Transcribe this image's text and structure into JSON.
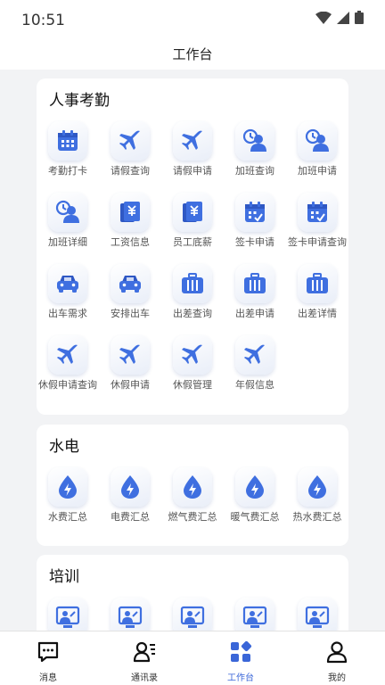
{
  "status": {
    "time": "10:51"
  },
  "header": {
    "title": "工作台"
  },
  "sections": [
    {
      "title": "人事考勤",
      "items": [
        {
          "label": "考勤打卡",
          "icon": "calendar-icon"
        },
        {
          "label": "请假查询",
          "icon": "airplane-icon"
        },
        {
          "label": "请假申请",
          "icon": "airplane-icon"
        },
        {
          "label": "加班查询",
          "icon": "clock-user-icon"
        },
        {
          "label": "加班申请",
          "icon": "clock-user-icon"
        },
        {
          "label": "加班详细",
          "icon": "clock-user-icon"
        },
        {
          "label": "工资信息",
          "icon": "salary-icon"
        },
        {
          "label": "员工底薪",
          "icon": "salary-icon"
        },
        {
          "label": "签卡申请",
          "icon": "calendar-check-icon"
        },
        {
          "label": "签卡申请查询",
          "icon": "calendar-check-icon"
        },
        {
          "label": "出车需求",
          "icon": "car-icon"
        },
        {
          "label": "安排出车",
          "icon": "car-icon"
        },
        {
          "label": "出差查询",
          "icon": "suitcase-icon"
        },
        {
          "label": "出差申请",
          "icon": "suitcase-icon"
        },
        {
          "label": "出差详情",
          "icon": "suitcase-icon"
        },
        {
          "label": "休假申请查询",
          "icon": "airplane-icon"
        },
        {
          "label": "休假申请",
          "icon": "airplane-icon"
        },
        {
          "label": "休假管理",
          "icon": "airplane-icon"
        },
        {
          "label": "年假信息",
          "icon": "airplane-icon"
        }
      ]
    },
    {
      "title": "水电",
      "items": [
        {
          "label": "水费汇总",
          "icon": "drop-bolt-icon"
        },
        {
          "label": "电费汇总",
          "icon": "drop-bolt-icon"
        },
        {
          "label": "燃气费汇总",
          "icon": "drop-bolt-icon"
        },
        {
          "label": "暖气费汇总",
          "icon": "drop-bolt-icon"
        },
        {
          "label": "热水费汇总",
          "icon": "drop-bolt-icon"
        }
      ]
    },
    {
      "title": "培训",
      "items": [
        {
          "label": "",
          "icon": "training-icon"
        },
        {
          "label": "",
          "icon": "training-icon"
        },
        {
          "label": "",
          "icon": "training-icon"
        },
        {
          "label": "",
          "icon": "training-icon"
        },
        {
          "label": "",
          "icon": "training-icon"
        }
      ]
    }
  ],
  "tabbar": {
    "items": [
      {
        "label": "消息",
        "icon": "message-icon",
        "active": false
      },
      {
        "label": "通讯录",
        "icon": "contacts-icon",
        "active": false
      },
      {
        "label": "工作台",
        "icon": "workbench-icon",
        "active": true
      },
      {
        "label": "我的",
        "icon": "profile-icon",
        "active": false
      }
    ]
  },
  "colors": {
    "accent": "#3a66d8",
    "icon_blue": "#3f6fe0",
    "background": "#f2f3f5"
  }
}
